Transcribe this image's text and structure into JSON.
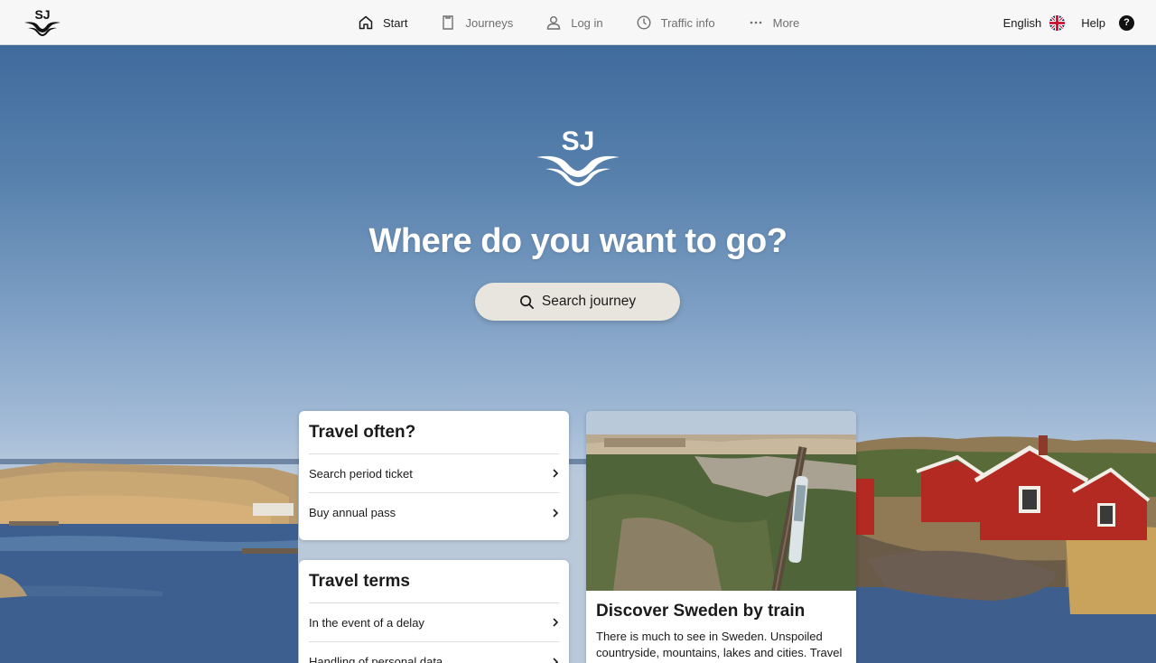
{
  "header": {
    "logo_text": "SJ",
    "nav": [
      {
        "label": "Start",
        "icon": "home-icon",
        "active": true
      },
      {
        "label": "Journeys",
        "icon": "ticket-icon",
        "active": false
      },
      {
        "label": "Log in",
        "icon": "user-icon",
        "active": false
      },
      {
        "label": "Traffic info",
        "icon": "clock-icon",
        "active": false
      },
      {
        "label": "More",
        "icon": "more-dots-icon",
        "active": false
      }
    ],
    "language": "English",
    "language_flag": "uk-flag-icon",
    "help": "Help",
    "help_icon": "?"
  },
  "hero": {
    "logo_text": "SJ",
    "title": "Where do you want to go?",
    "search_label": "Search journey"
  },
  "travel_often": {
    "title": "Travel often?",
    "links": [
      "Search period ticket",
      "Buy annual pass"
    ]
  },
  "travel_terms": {
    "title": "Travel terms",
    "links": [
      "In the event of a delay",
      "Handling of personal data"
    ]
  },
  "discover": {
    "title": "Discover Sweden by train",
    "text": "There is much to see in Sweden. Unspoiled countryside, mountains, lakes and cities. Travel"
  },
  "colors": {
    "header_bg": "#f7f7f7",
    "sky_top": "#3f6b9c",
    "search_button_bg": "#e8e5df",
    "house_red": "#b22a22",
    "water": "#3d5f8f"
  }
}
